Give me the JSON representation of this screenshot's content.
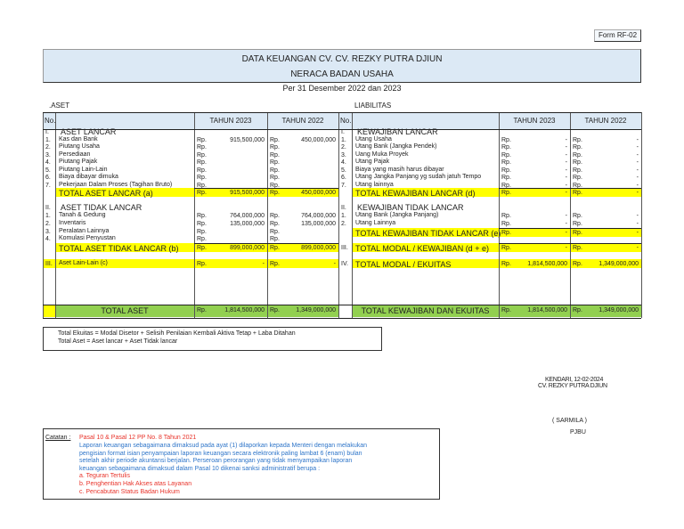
{
  "form_code": "Form RF-02",
  "header": {
    "title": "DATA KEUANGAN CV. CV. REZKY PUTRA DJIUN",
    "subtitle": "NERACA BADAN USAHA",
    "period": "Per 31 Desember 2022 dan 2023"
  },
  "colors": {
    "header_bg": "#dce9f5",
    "total_highlight": "#ffff00",
    "grand_total": "#92d050"
  },
  "currency": "Rp.",
  "aset": {
    "section_label": ".ASET",
    "col_no": "No.",
    "col_2023": "TAHUN 2023",
    "col_2022": "TAHUN 2022",
    "lancar": {
      "no": "I.",
      "title": "ASET LANCAR",
      "items": [
        {
          "no": "1.",
          "label": "Kas dan Bank",
          "v2023": "915,500,000",
          "v2022": "450,000,000"
        },
        {
          "no": "2.",
          "label": "Piutang Usaha",
          "v2023": "",
          "v2022": ""
        },
        {
          "no": "3.",
          "label": "Persediaan",
          "v2023": "",
          "v2022": ""
        },
        {
          "no": "4.",
          "label": "Piutang Pajak",
          "v2023": "",
          "v2022": ""
        },
        {
          "no": "5.",
          "label": "Piutang Lain-Lain",
          "v2023": "",
          "v2022": ""
        },
        {
          "no": "6.",
          "label": "Biaya dibayar dimuka",
          "v2023": "",
          "v2022": ""
        },
        {
          "no": "7.",
          "label": "Pekerjaan Dalam Proses (Tagihan Bruto)",
          "v2023": "",
          "v2022": ""
        }
      ],
      "total": {
        "label": "TOTAL ASET LANCAR (a)",
        "v2023": "915,500,000",
        "v2022": "450,000,000"
      }
    },
    "tidak_lancar": {
      "no": "II.",
      "title": "ASET TIDAK LANCAR",
      "items": [
        {
          "no": "1.",
          "label": "Tanah & Gedung",
          "v2023": "764,000,000",
          "v2022": "764,000,000"
        },
        {
          "no": "2.",
          "label": "Inventaris",
          "v2023": "135,000,000",
          "v2022": "135,000,000"
        },
        {
          "no": "3.",
          "label": "Peralatan Lainnya",
          "v2023": "",
          "v2022": ""
        },
        {
          "no": "4.",
          "label": "Komulasi Penyustan",
          "v2023": "",
          "v2022": ""
        }
      ],
      "total": {
        "label": "TOTAL ASET TIDAK LANCAR (b)",
        "v2023": "899,000,000",
        "v2022": "899,000,000"
      }
    },
    "lain": {
      "no": "III.",
      "label": "Aset Lain-Lain (c)",
      "v2023": "-",
      "v2022": "-"
    },
    "grand_total": {
      "label": "TOTAL ASET",
      "v2023": "1,814,500,000",
      "v2022": "1,349,000,000"
    }
  },
  "liabilitas": {
    "section_label": "LIABILITAS",
    "col_no": "No.",
    "col_2023": "TAHUN 2023",
    "col_2022": "TAHUN 2022",
    "lancar": {
      "no": "I.",
      "title": "KEWAJIBAN LANCAR",
      "items": [
        {
          "no": "1.",
          "label": "Utang Usaha",
          "v2023": "-",
          "v2022": "-"
        },
        {
          "no": "2.",
          "label": "Utang Bank (Jangka Pendek)",
          "v2023": "-",
          "v2022": "-"
        },
        {
          "no": "3.",
          "label": "Uang Muka Proyek",
          "v2023": "-",
          "v2022": "-"
        },
        {
          "no": "4.",
          "label": "Utang Pajak",
          "v2023": "-",
          "v2022": "-"
        },
        {
          "no": "5.",
          "label": "Biaya yang masih harus dibayar",
          "v2023": "-",
          "v2022": "-"
        },
        {
          "no": "6.",
          "label": "Utang Jangka Panjang yg sudah jatuh Tempo",
          "v2023": "-",
          "v2022": "-"
        },
        {
          "no": "7.",
          "label": "Utang lainnya",
          "v2023": "-",
          "v2022": "-"
        }
      ],
      "total": {
        "label": "TOTAL KEWAJIBAN LANCAR (d)",
        "v2023": "-",
        "v2022": "-"
      }
    },
    "tidak_lancar": {
      "no": "II.",
      "title": "KEWAJIBAN TIDAK LANCAR",
      "items": [
        {
          "no": "1.",
          "label": "Utang Bank (Jangka Panjang)",
          "v2023": "-",
          "v2022": "-"
        },
        {
          "no": "2.",
          "label": "Utang Lainnya",
          "v2023": "-",
          "v2022": "-"
        }
      ],
      "total": {
        "label": "TOTAL KEWAJIBAN TIDAK LANCAR (e)",
        "v2023": "-",
        "v2022": "-"
      }
    },
    "modal_kewajiban": {
      "no": "III.",
      "label": "TOTAL MODAL / KEWAJIBAN (d + e)",
      "v2023": "-",
      "v2022": "-"
    },
    "modal_ekuitas": {
      "no": "IV.",
      "label": "TOTAL MODAL / EKUITAS",
      "v2023": "1,814,500,000",
      "v2022": "1,349,000,000"
    },
    "grand_total": {
      "label": "TOTAL KEWAJIBAN DAN EKUITAS",
      "v2023": "1,814,500,000",
      "v2022": "1,349,000,000"
    }
  },
  "formulas": [
    "Total Ekuitas = Modal Disetor + Selisih Penilaian Kembali Aktiva Tetap + Laba Ditahan",
    "Total Aset = Aset lancar + Aset Tidak lancar"
  ],
  "signature": {
    "place_date": "KENDARI, 12-02-2024",
    "company": "CV. REZKY PUTRA DJIUN",
    "name": "( SARMILA )",
    "role": "PJBU"
  },
  "notes": {
    "label": "Catatan :",
    "heading": "Pasal 10 & Pasal 12 PP No. 8 Tahun 2021",
    "body": [
      "Laporan keuangan sebagaimana dimaksud pada ayat (1) dilaporkan kepada Menteri dengan melakukan",
      "pengisian format isian penyampaian laporan keuangan secara elektronik paling lambat 6 (enam) bulan",
      "setelah akhir periode akuntansi berjalan. Perseroan perorangan yang tidak menyampaikan laporan",
      "keuangan sebagaimana dimaksud dalam Pasal 10 dikenai sanksi administratif berupa :"
    ],
    "sanctions": [
      "a. Teguran Tertulis",
      "b. Penghentian Hak Akses atas Layanan",
      "c. Pencabutan Status Badan Hukum"
    ]
  }
}
